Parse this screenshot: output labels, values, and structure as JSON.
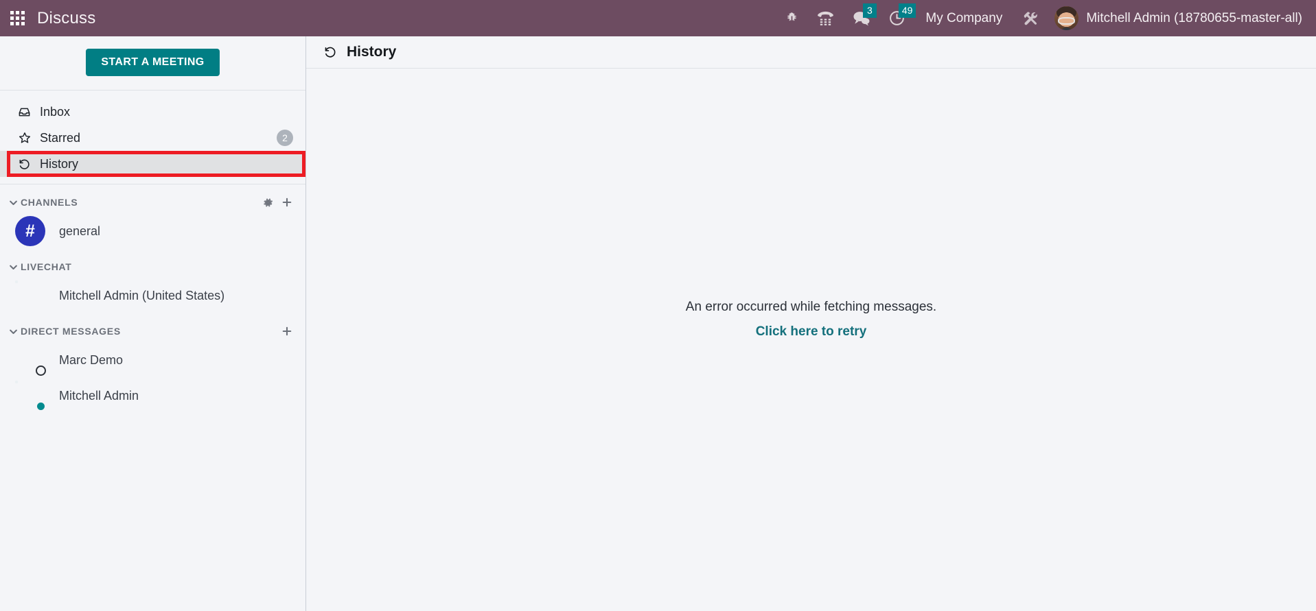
{
  "navbar": {
    "apps_icon": "apps-grid-icon",
    "brand": "Discuss",
    "bug_icon": "bug-icon",
    "phone_icon": "phone-dialpad-icon",
    "messages_icon": "chat-bubble-icon",
    "messages_count": "3",
    "activities_icon": "clock-icon",
    "activities_count": "49",
    "company": "My Company",
    "tools_icon": "wrench-screwdriver-icon",
    "user_name": "Mitchell Admin (18780655-master-all)",
    "avatar_icon": "user-avatar",
    "bg_color": "#6d4c61",
    "badge_color": "#01808a"
  },
  "sidebar": {
    "start_meeting_label": "START A MEETING",
    "start_meeting_color": "#017e84",
    "mailboxes": [
      {
        "label": "Inbox",
        "icon": "inbox-icon",
        "counter": "",
        "active": false
      },
      {
        "label": "Starred",
        "icon": "star-icon",
        "counter": "2",
        "active": false
      },
      {
        "label": "History",
        "icon": "history-icon",
        "counter": "",
        "active": true
      }
    ],
    "groups": [
      {
        "title": "CHANNELS",
        "caret_icon": "chevron-down-icon",
        "has_gear": true,
        "gear_icon": "gear-icon",
        "has_add": true,
        "add_icon": "plus-icon",
        "items": [
          {
            "name": "general",
            "type": "hash",
            "hash_color": "#2b35b8",
            "status": ""
          }
        ]
      },
      {
        "title": "LIVECHAT",
        "caret_icon": "chevron-down-icon",
        "has_gear": false,
        "has_add": false,
        "items": [
          {
            "name": "Mitchell Admin (United States)",
            "type": "avatar",
            "avatar_style": "glasses",
            "status": ""
          }
        ]
      },
      {
        "title": "DIRECT MESSAGES",
        "caret_icon": "chevron-down-icon",
        "has_gear": false,
        "has_add": true,
        "add_icon": "plus-icon",
        "items": [
          {
            "name": "Marc Demo",
            "type": "avatar",
            "avatar_style": "marc",
            "status": "offline"
          },
          {
            "name": "Mitchell Admin",
            "type": "avatar",
            "avatar_style": "glasses",
            "status": "online"
          }
        ]
      }
    ]
  },
  "main": {
    "title": "History",
    "title_icon": "history-icon",
    "error_text": "An error occurred while fetching messages.",
    "retry_label": "Click here to retry",
    "retry_color": "#14707c"
  },
  "annotation": {
    "highlight_color": "#ed1c24",
    "target": "History"
  }
}
